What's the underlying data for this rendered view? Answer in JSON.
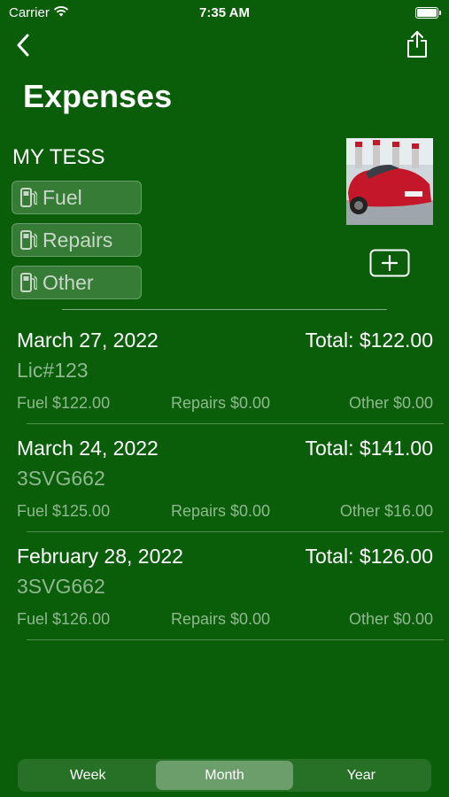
{
  "status": {
    "carrier": "Carrier",
    "time": "7:35 AM"
  },
  "header": {
    "title": "Expenses"
  },
  "car": {
    "name": "MY TESS",
    "categories": {
      "fuel": "Fuel",
      "repairs": "Repairs",
      "other": "Other"
    }
  },
  "expenses": [
    {
      "date": "March 27, 2022",
      "total": "Total: $122.00",
      "plate": "Lic#123",
      "fuel": "Fuel $122.00",
      "repairs": "Repairs $0.00",
      "other": "Other $0.00"
    },
    {
      "date": "March 24, 2022",
      "total": "Total: $141.00",
      "plate": "3SVG662",
      "fuel": "Fuel $125.00",
      "repairs": "Repairs $0.00",
      "other": "Other $16.00"
    },
    {
      "date": "February 28, 2022",
      "total": "Total: $126.00",
      "plate": "3SVG662",
      "fuel": "Fuel $126.00",
      "repairs": "Repairs $0.00",
      "other": "Other $0.00"
    }
  ],
  "period": {
    "options": [
      "Week",
      "Month",
      "Year"
    ],
    "selected": "Month"
  },
  "colors": {
    "background": "#0a5e0a",
    "muted_text": "#8fb88f",
    "car_red": "#c4182a"
  }
}
